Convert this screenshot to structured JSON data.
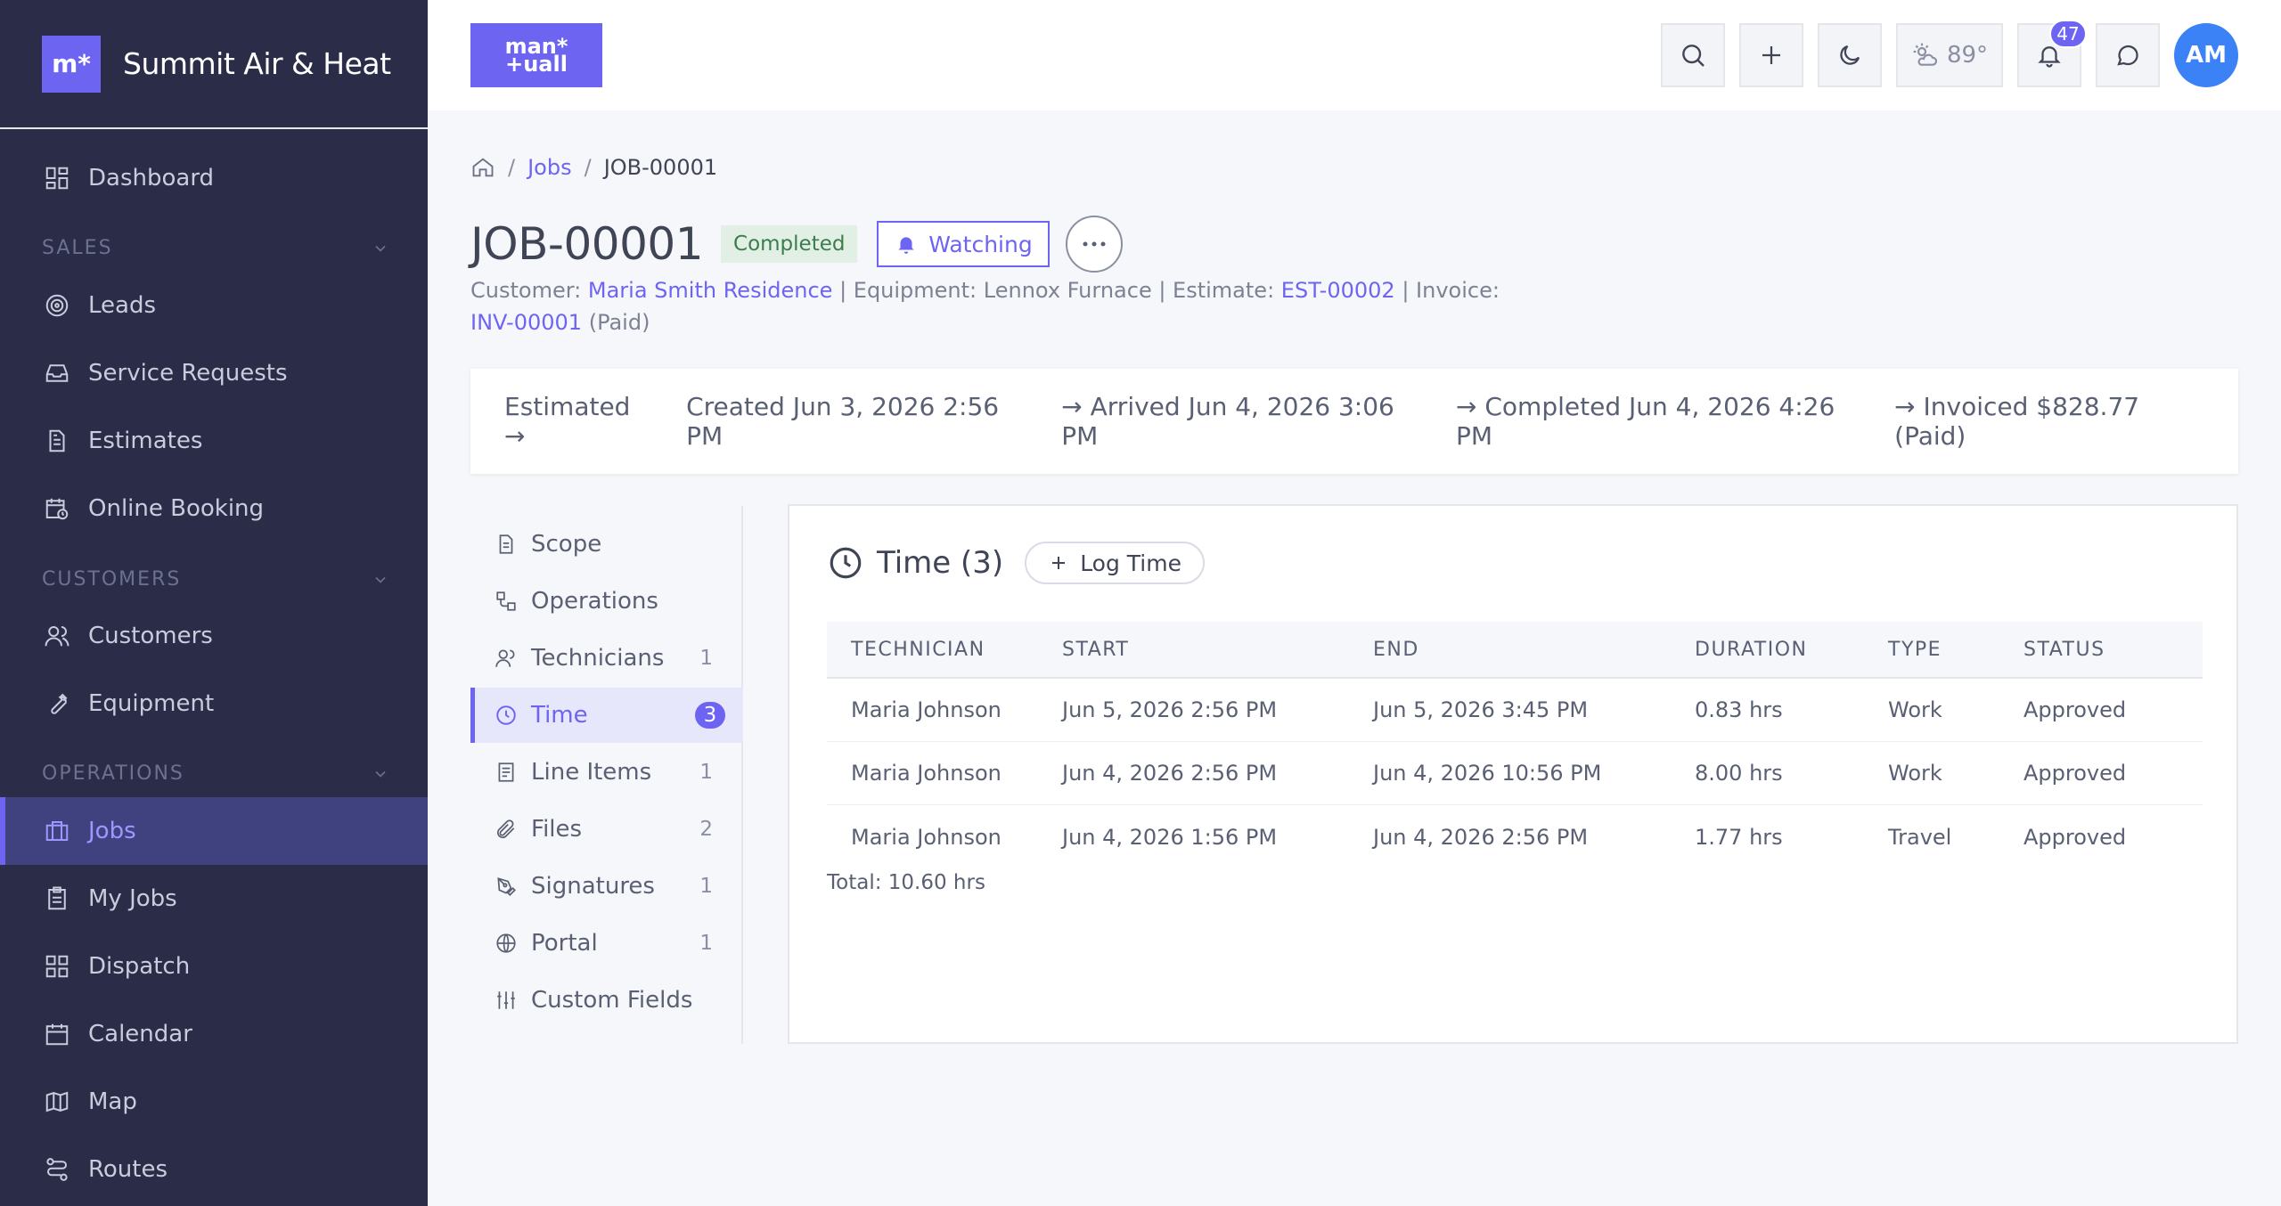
{
  "brand": {
    "logo": "m*",
    "name": "Summit Air & Heat"
  },
  "sidebar": {
    "items": [
      {
        "id": "dashboard",
        "label": "Dashboard",
        "icon": "grid-icon"
      },
      {
        "id": "leads",
        "label": "Leads",
        "icon": "target-icon"
      },
      {
        "id": "service-requests",
        "label": "Service Requests",
        "icon": "inbox-icon"
      },
      {
        "id": "estimates",
        "label": "Estimates",
        "icon": "document-icon"
      },
      {
        "id": "online-booking",
        "label": "Online Booking",
        "icon": "calendar-clock-icon"
      },
      {
        "id": "customers",
        "label": "Customers",
        "icon": "users-icon"
      },
      {
        "id": "equipment",
        "label": "Equipment",
        "icon": "wrench-icon"
      },
      {
        "id": "jobs",
        "label": "Jobs",
        "icon": "briefcase-icon"
      },
      {
        "id": "my-jobs",
        "label": "My Jobs",
        "icon": "clipboard-icon"
      },
      {
        "id": "dispatch",
        "label": "Dispatch",
        "icon": "grid-icon"
      },
      {
        "id": "calendar",
        "label": "Calendar",
        "icon": "calendar-icon"
      },
      {
        "id": "map",
        "label": "Map",
        "icon": "map-icon"
      },
      {
        "id": "routes",
        "label": "Routes",
        "icon": "route-icon"
      }
    ],
    "sections": {
      "sales": "SALES",
      "customers": "CUSTOMERS",
      "operations": "OPERATIONS"
    }
  },
  "topbar": {
    "logo_line1": "man*",
    "logo_line2": "+uall",
    "weather": "89°",
    "notifications_count": "47",
    "avatar_initials": "AM"
  },
  "breadcrumb": {
    "jobs": "Jobs",
    "current": "JOB-00001"
  },
  "job": {
    "title": "JOB-00001",
    "status": "Completed",
    "watch_label": "Watching",
    "customer_label": "Customer:",
    "customer": "Maria Smith Residence",
    "equipment_text": "| Equipment: Lennox Furnace | Estimate:",
    "estimate": "EST-00002",
    "invoice_label": "| Invoice:",
    "invoice": "INV-00001",
    "invoice_status": "(Paid)"
  },
  "timeline": [
    "Estimated →",
    "Created Jun 3, 2026 2:56 PM",
    "→ Arrived Jun 4, 2026 3:06 PM",
    "→ Completed Jun 4, 2026 4:26 PM",
    "→ Invoiced $828.77 (Paid)"
  ],
  "tabs": [
    {
      "id": "scope",
      "label": "Scope",
      "count": "",
      "icon": "document-icon"
    },
    {
      "id": "operations",
      "label": "Operations",
      "count": "",
      "icon": "flow-icon"
    },
    {
      "id": "technicians",
      "label": "Technicians",
      "count": "1",
      "icon": "users-icon"
    },
    {
      "id": "time",
      "label": "Time",
      "count": "3",
      "icon": "clock-icon",
      "active": true
    },
    {
      "id": "line-items",
      "label": "Line Items",
      "count": "1",
      "icon": "list-icon"
    },
    {
      "id": "files",
      "label": "Files",
      "count": "2",
      "icon": "paperclip-icon"
    },
    {
      "id": "signatures",
      "label": "Signatures",
      "count": "1",
      "icon": "pen-icon"
    },
    {
      "id": "portal",
      "label": "Portal",
      "count": "1",
      "icon": "globe-icon"
    },
    {
      "id": "custom-fields",
      "label": "Custom Fields",
      "count": "",
      "icon": "sliders-icon"
    }
  ],
  "time_panel": {
    "title": "Time (3)",
    "log_button": "Log Time",
    "columns": [
      "TECHNICIAN",
      "START",
      "END",
      "DURATION",
      "TYPE",
      "STATUS"
    ],
    "rows": [
      [
        "Maria Johnson",
        "Jun 5, 2026 2:56 PM",
        "Jun 5, 2026 3:45 PM",
        "0.83 hrs",
        "Work",
        "Approved"
      ],
      [
        "Maria Johnson",
        "Jun 4, 2026 2:56 PM",
        "Jun 4, 2026 10:56 PM",
        "8.00 hrs",
        "Work",
        "Approved"
      ],
      [
        "Maria Johnson",
        "Jun 4, 2026 1:56 PM",
        "Jun 4, 2026 2:56 PM",
        "1.77 hrs",
        "Travel",
        "Approved"
      ]
    ],
    "total": "Total: 10.60 hrs"
  },
  "colors": {
    "accent": "#6d65f2",
    "sidebar_bg": "#2a2c48",
    "success": "#3b7d4e",
    "avatar": "#3b82f6"
  }
}
